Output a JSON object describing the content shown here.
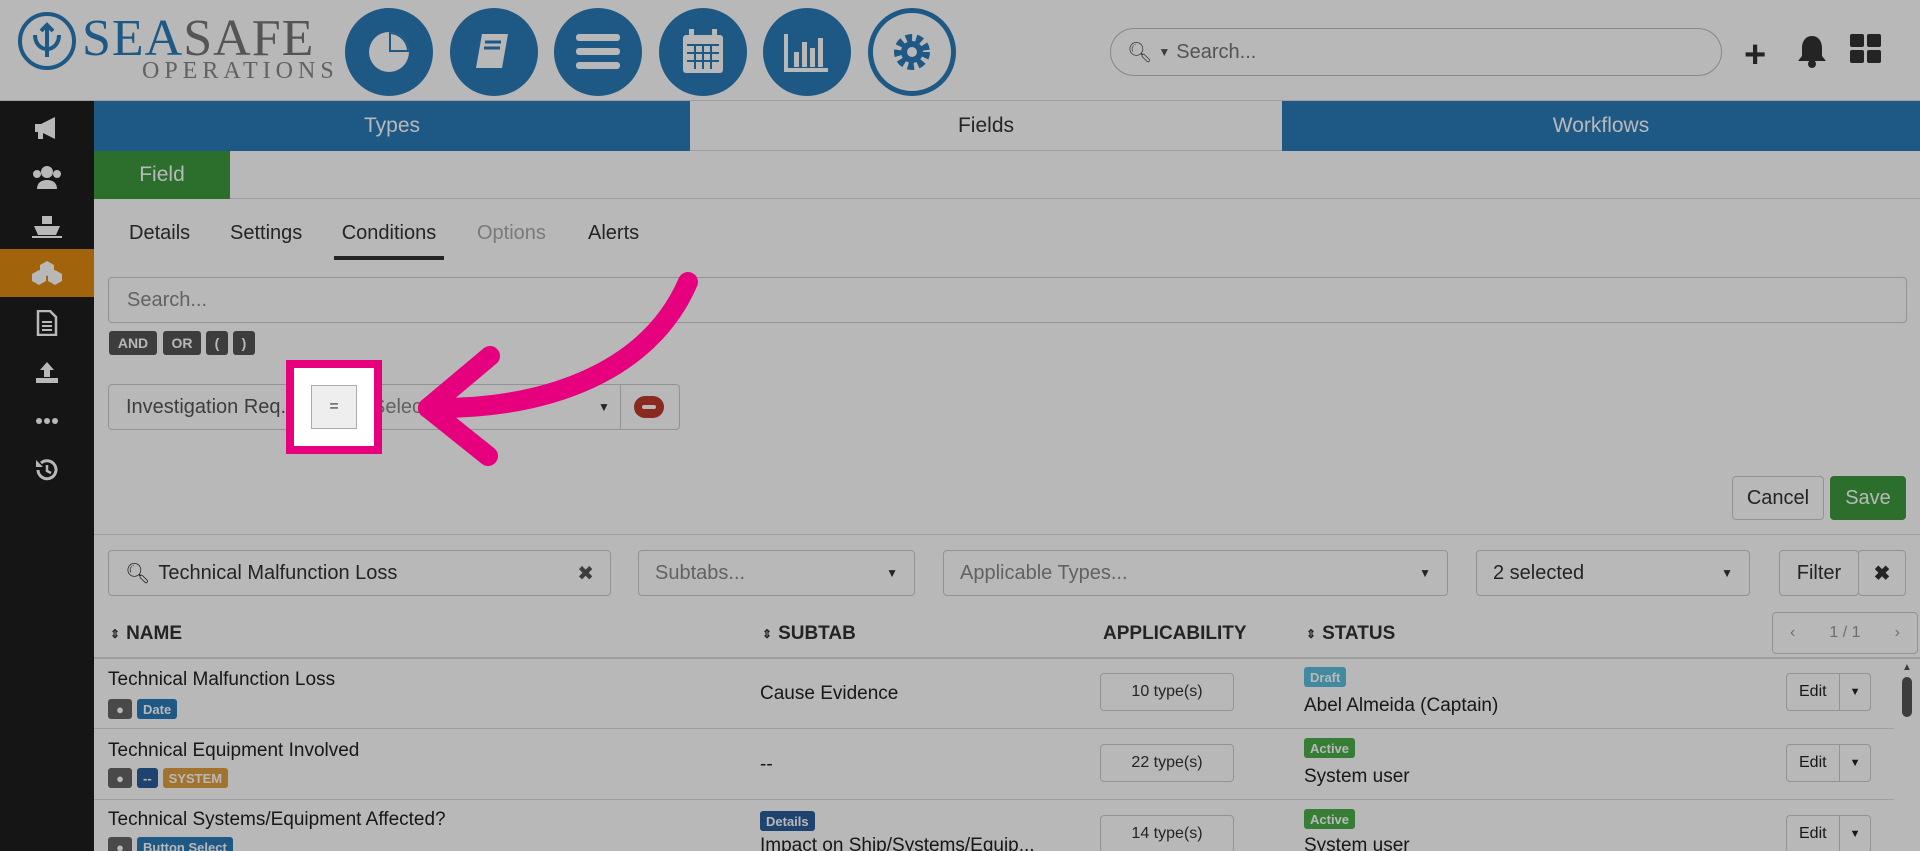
{
  "brand": {
    "sea": "SEA",
    "safe": "SAFE",
    "sub": "OPERATIONS"
  },
  "header": {
    "nav_icons": [
      "dashboard-icon",
      "book-icon",
      "menu-icon",
      "calendar-icon",
      "bar-chart-icon",
      "settings-icon"
    ],
    "search_placeholder": "Search...",
    "accent": "#2a7ab8"
  },
  "sidebar": {
    "items": [
      "megaphone-icon",
      "users-icon",
      "ship-icon",
      "boxes-icon",
      "document-icon",
      "upload-icon",
      "more-icon",
      "history-icon"
    ],
    "active_index": 3,
    "active_color": "#e08a10"
  },
  "tabs": {
    "types": "Types",
    "fields": "Fields",
    "workflows": "Workflows"
  },
  "field_button": "Field",
  "subtabs": {
    "details": "Details",
    "settings": "Settings",
    "conditions": "Conditions",
    "options": "Options",
    "alerts": "Alerts"
  },
  "conditions": {
    "search_placeholder": "Search...",
    "operators": [
      "AND",
      "OR",
      "(",
      ")"
    ],
    "field": "Investigation Req...",
    "operator": "=",
    "select_placeholder": "Select"
  },
  "actions": {
    "cancel": "Cancel",
    "save": "Save"
  },
  "filters": {
    "search_value": "Technical Malfunction Loss",
    "subtabs_placeholder": "Subtabs...",
    "types_placeholder": "Applicable Types...",
    "status_selected": "2 selected",
    "filter_label": "Filter"
  },
  "table": {
    "headers": {
      "name": "NAME",
      "subtab": "SUBTAB",
      "applicability": "APPLICABILITY",
      "status": "STATUS"
    },
    "pager": "1 / 1",
    "edit_label": "Edit",
    "rows": [
      {
        "name": "Technical Malfunction Loss",
        "tags": [
          "Date"
        ],
        "subtab_tag": "",
        "subtab": "Cause Evidence",
        "types": "10 type(s)",
        "status": "Draft",
        "user": "Abel Almeida (Captain)"
      },
      {
        "name": "Technical Equipment Involved",
        "tags": [
          "--",
          "SYSTEM"
        ],
        "subtab_tag": "",
        "subtab": "--",
        "types": "22 type(s)",
        "status": "Active",
        "user": "System user"
      },
      {
        "name": "Technical Systems/Equipment Affected?",
        "tags": [
          "Button Select"
        ],
        "subtab_tag": "Details",
        "subtab": "Impact on Ship/Systems/Equip...",
        "types": "14 type(s)",
        "status": "Active",
        "user": "System user"
      }
    ]
  },
  "highlight_color": "#e6007e"
}
